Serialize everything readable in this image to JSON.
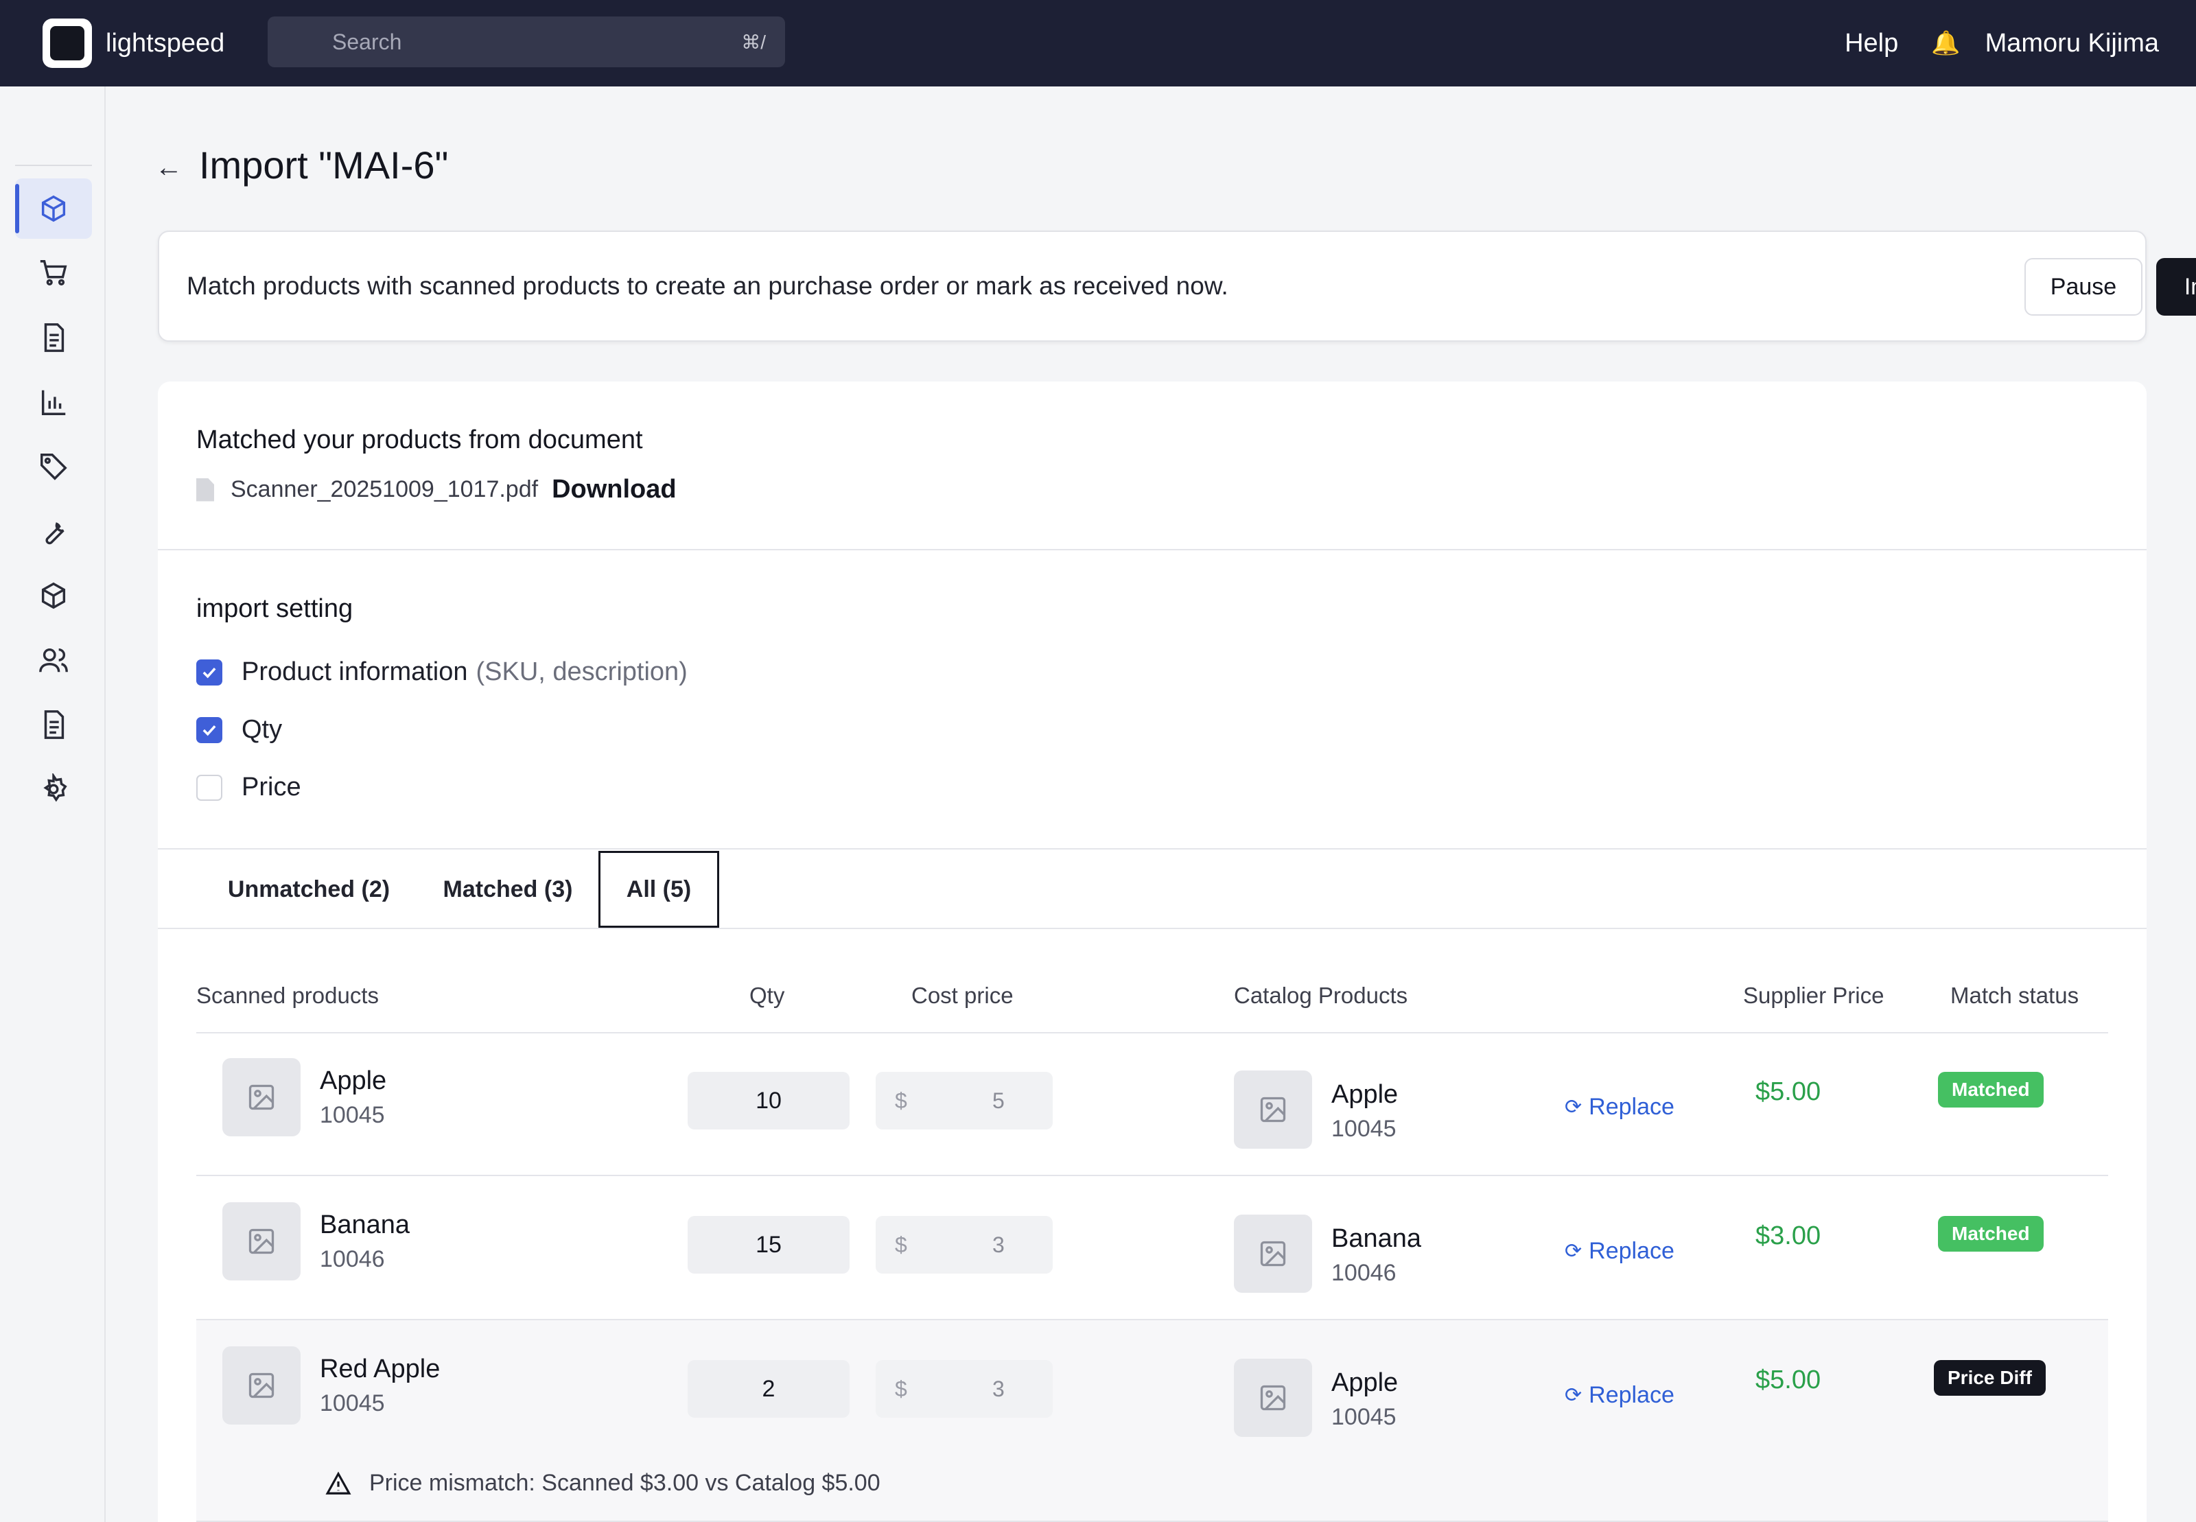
{
  "app": {
    "brand": "lightspeed",
    "search_placeholder": "Search",
    "search_shortcut": "⌘/",
    "help_label": "Help",
    "user_name": "Mamoru Kijima"
  },
  "sidebar": {
    "items": [
      {
        "icon": "home-icon"
      },
      {
        "icon": "box-icon",
        "active": true
      },
      {
        "icon": "cart-icon"
      },
      {
        "icon": "document-icon"
      },
      {
        "icon": "chart-icon"
      },
      {
        "icon": "tag-icon"
      },
      {
        "icon": "wrench-icon"
      },
      {
        "icon": "package-icon"
      },
      {
        "icon": "users-icon"
      },
      {
        "icon": "report-icon"
      },
      {
        "icon": "gear-icon"
      }
    ]
  },
  "page": {
    "title": "Import \"MAI-6\"",
    "banner_message": "Match products with scanned products to create an purchase order or mark as received now.",
    "pause_label": "Pause",
    "import_label": "Import"
  },
  "document": {
    "heading": "Matched your products from document",
    "file_name": "Scanner_20251009_1017.pdf",
    "download_label": "Download"
  },
  "settings": {
    "heading": "import setting",
    "options": [
      {
        "label": "Product information",
        "hint": "(SKU, description)",
        "checked": true
      },
      {
        "label": "Qty",
        "hint": "",
        "checked": true
      },
      {
        "label": "Price",
        "hint": "",
        "checked": false
      }
    ]
  },
  "tabs": [
    {
      "label": "Unmatched (2)",
      "active": false
    },
    {
      "label": "Matched (3)",
      "active": false
    },
    {
      "label": "All (5)",
      "active": true
    }
  ],
  "table": {
    "columns": {
      "scanned": "Scanned products",
      "qty": "Qty",
      "cost": "Cost price",
      "catalog": "Catalog Products",
      "supplier_price": "Supplier Price",
      "status": "Match status"
    },
    "currency_symbol": "$",
    "replace_label": "Replace",
    "rows": [
      {
        "scanned_name": "Apple",
        "scanned_sku": "10045",
        "qty": "10",
        "cost": "5",
        "catalog_name": "Apple",
        "catalog_sku": "10045",
        "supplier_price": "$5.00",
        "status": "Matched"
      },
      {
        "scanned_name": "Banana",
        "scanned_sku": "10046",
        "qty": "15",
        "cost": "3",
        "catalog_name": "Banana",
        "catalog_sku": "10046",
        "supplier_price": "$3.00",
        "status": "Matched"
      },
      {
        "scanned_name": "Red Apple",
        "scanned_sku": "10045",
        "qty": "2",
        "cost": "3",
        "catalog_name": "Apple",
        "catalog_sku": "10045",
        "supplier_price": "$5.00",
        "status": "Price Diff",
        "warning": "Price mismatch: Scanned $3.00 vs Catalog $5.00"
      }
    ]
  },
  "colors": {
    "topbar": "#1d2035",
    "accent": "#3f5fd8",
    "matched": "#45c062",
    "price_green": "#2aa04a",
    "link_blue": "#2f5fd6"
  }
}
